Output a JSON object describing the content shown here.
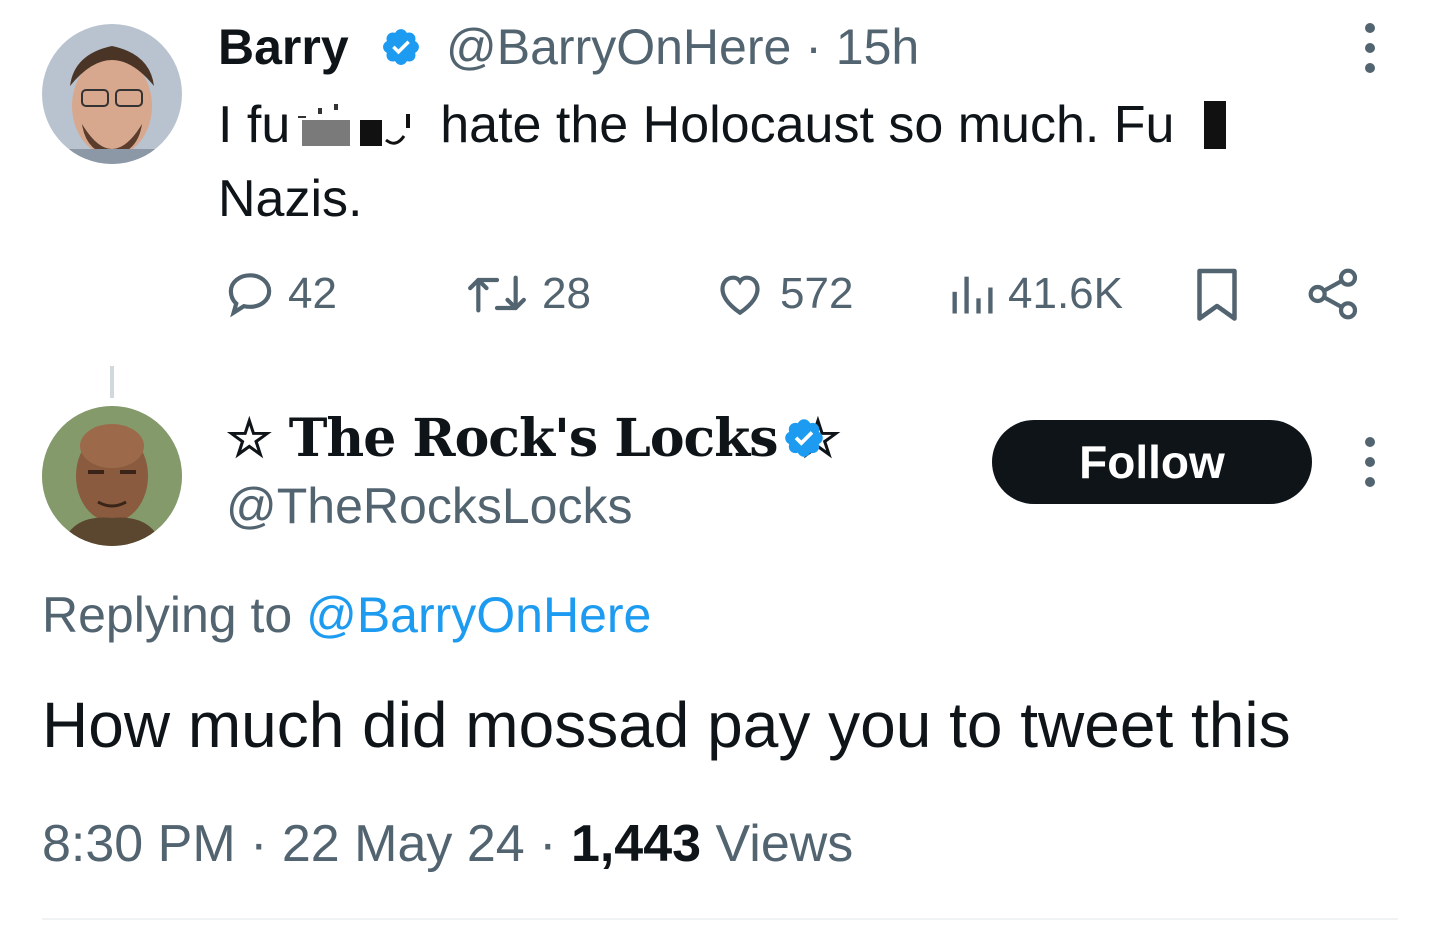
{
  "parent_tweet": {
    "author_name": "Barry",
    "author_handle": "@BarryOnHere",
    "separator": "·",
    "time_ago": "15h",
    "text_part1": "I fu",
    "text_part2": "hate the Holocaust so much. Fu",
    "text_line2": "Nazis.",
    "stats": {
      "replies": "42",
      "reposts": "28",
      "likes": "572",
      "views": "41.6K"
    }
  },
  "reply_tweet": {
    "author_name": "☆ The Rock's Locks ☆",
    "author_handle": "@TheRocksLocks",
    "follow_label": "Follow",
    "replying_prefix": "Replying to",
    "replying_mention": "@BarryOnHere",
    "text": "How much did mossad pay you to tweet this",
    "time": "8:30 PM",
    "date": "22 May 24",
    "views_count": "1,443",
    "views_label": "Views",
    "separator": "·"
  },
  "colors": {
    "verified_blue": "#1d9bf0",
    "muted_text": "#536471",
    "primary_text": "#0f1419",
    "follow_bg": "#0f1419",
    "divider": "#eff3f4"
  },
  "icons": [
    "verified-badge-icon",
    "more-icon",
    "reply-icon",
    "repost-icon",
    "like-icon",
    "views-icon",
    "bookmark-icon",
    "share-icon"
  ]
}
